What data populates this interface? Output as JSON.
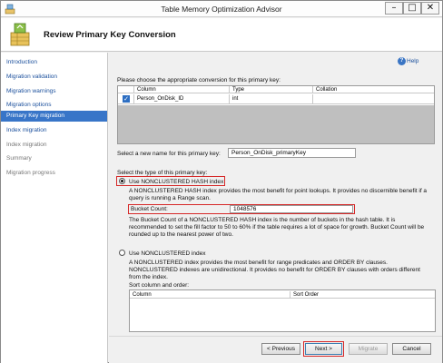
{
  "window": {
    "title": "Table Memory Optimization Advisor",
    "minimize_glyph": "–",
    "maximize_glyph": "□",
    "close_glyph": "✕"
  },
  "header": {
    "title": "Review Primary Key Conversion"
  },
  "sidebar": {
    "items": [
      {
        "label": "Introduction",
        "state": "link"
      },
      {
        "label": "Migration validation",
        "state": "link"
      },
      {
        "label": "Migration warnings",
        "state": "link"
      },
      {
        "label": "Migration options",
        "state": "link"
      },
      {
        "label": "Primary Key migration",
        "state": "active"
      },
      {
        "label": "Index migration",
        "state": "link"
      },
      {
        "label": "Index migration",
        "state": "disabled"
      },
      {
        "label": "Summary",
        "state": "disabled"
      },
      {
        "label": "Migration progress",
        "state": "disabled"
      }
    ]
  },
  "help": {
    "label": "Help"
  },
  "pk_section": {
    "prompt": "Please choose the appropriate conversion for this primary key:",
    "columns": [
      "Column",
      "Type",
      "Collation"
    ],
    "rows": [
      {
        "checked": true,
        "column": "Person_OnDisk_ID",
        "type": "int",
        "collation": ""
      }
    ]
  },
  "name_section": {
    "label": "Select a new name for this primary key:",
    "value": "Person_OnDisk_primaryKey"
  },
  "type_section": {
    "label": "Select the type of this primary key:",
    "hash_option": {
      "label": "Use NONCLUSTERED HASH index",
      "selected": true,
      "description": "A NONCLUSTERED HASH index provides the most benefit for point lookups. It provides no discernible benefit if a query is running a Range scan.",
      "bucket_label": "Bucket Count:",
      "bucket_value": "1048576",
      "bucket_description": "The Bucket Count of a NONCLUSTERED HASH index is the number of buckets in the hash table. It is recommended to set the fill factor to 50 to 60% if the table requires a lot of space for growth. Bucket Count will be rounded up to the nearest power of two."
    },
    "nonclustered_option": {
      "label": "Use NONCLUSTERED index",
      "selected": false,
      "description": "A NONCLUSTERED index provides the most benefit for range predicates and ORDER BY clauses. NONCLUSTERED indexes are unidirectional. It provides no benefit for ORDER BY clauses with orders different from the index.",
      "sort_label": "Sort column and order:",
      "sort_columns": [
        "Column",
        "Sort Order"
      ]
    }
  },
  "footer": {
    "previous": "< Previous",
    "next": "Next >",
    "migrate": "Migrate",
    "cancel": "Cancel"
  },
  "colors": {
    "accent": "#3875c8",
    "link": "#1a4f9c",
    "highlight": "#d62828"
  }
}
